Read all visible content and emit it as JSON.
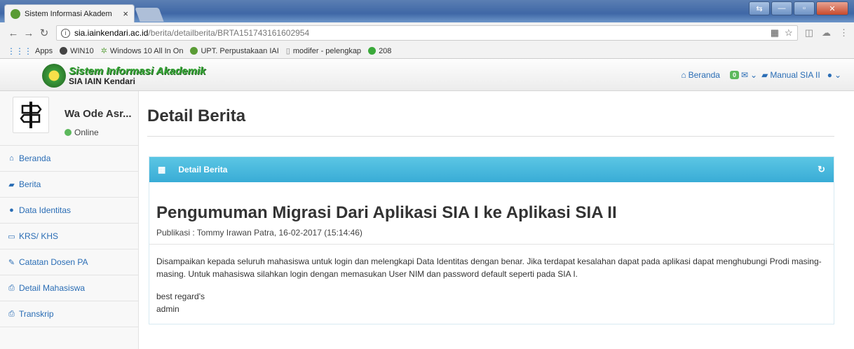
{
  "browser": {
    "tab_title": "Sistem Informasi Akadem",
    "tab_close": "×",
    "url_host": "sia.iainkendari.ac.id",
    "url_path": "/berita/detailberita/BRTA151743161602954",
    "info_symbol": "i",
    "bookmarks": [
      {
        "label": "Apps",
        "color": "#2277cc"
      },
      {
        "label": "WIN10",
        "color": "#444444"
      },
      {
        "label": "Windows 10 All In On",
        "color": "#6aa84f"
      },
      {
        "label": "UPT. Perpustakaan IAI",
        "color": "#5a9b35"
      },
      {
        "label": "modifer - pelengkap",
        "color": "#888888"
      },
      {
        "label": "208",
        "color": "#3aa93a"
      }
    ]
  },
  "navbar": {
    "brand_title": "Sistem Informasi Akademik",
    "brand_sub": "SIA IAIN Kendari",
    "home_label": "Beranda",
    "message_count": "0",
    "manual_label": "Manual SIA II"
  },
  "sidebar": {
    "user_name": "Wa Ode Asr...",
    "user_status": "Online",
    "items": [
      {
        "label": "Beranda",
        "icon": "home-icon",
        "glyph": "⌂"
      },
      {
        "label": "Berita",
        "icon": "book-icon",
        "glyph": "▰"
      },
      {
        "label": "Data Identitas",
        "icon": "user-icon",
        "glyph": "●"
      },
      {
        "label": "KRS/ KHS",
        "icon": "folder-open-icon",
        "glyph": "▭"
      },
      {
        "label": "Catatan Dosen PA",
        "icon": "edit-icon",
        "glyph": "✎"
      },
      {
        "label": "Detail Mahasiswa",
        "icon": "print-icon",
        "glyph": "⎙"
      },
      {
        "label": "Transkrip",
        "icon": "print-icon",
        "glyph": "⎙"
      }
    ]
  },
  "main": {
    "page_title": "Detail Berita",
    "panel_title": "Detail Berita",
    "news_title": "Pengumuman Migrasi Dari Aplikasi SIA I ke Aplikasi SIA II",
    "news_meta": "Publikasi : Tommy Irawan Patra, 16-02-2017 (15:14:46)",
    "news_paragraph": "Disampaikan kepada seluruh mahasiswa untuk login dan melengkapi Data Identitas dengan benar. Jika terdapat kesalahan dapat pada aplikasi dapat menghubungi Prodi masing-masing. Untuk mahasiswa silahkan login dengan memasukan User NIM dan password default seperti pada SIA I.",
    "news_regards": "best regard's",
    "news_signature": "admin"
  },
  "colors": {
    "accent": "#39acd6",
    "link": "#2a6db5",
    "online": "#5cb85c",
    "brand": "#3aa93a"
  }
}
